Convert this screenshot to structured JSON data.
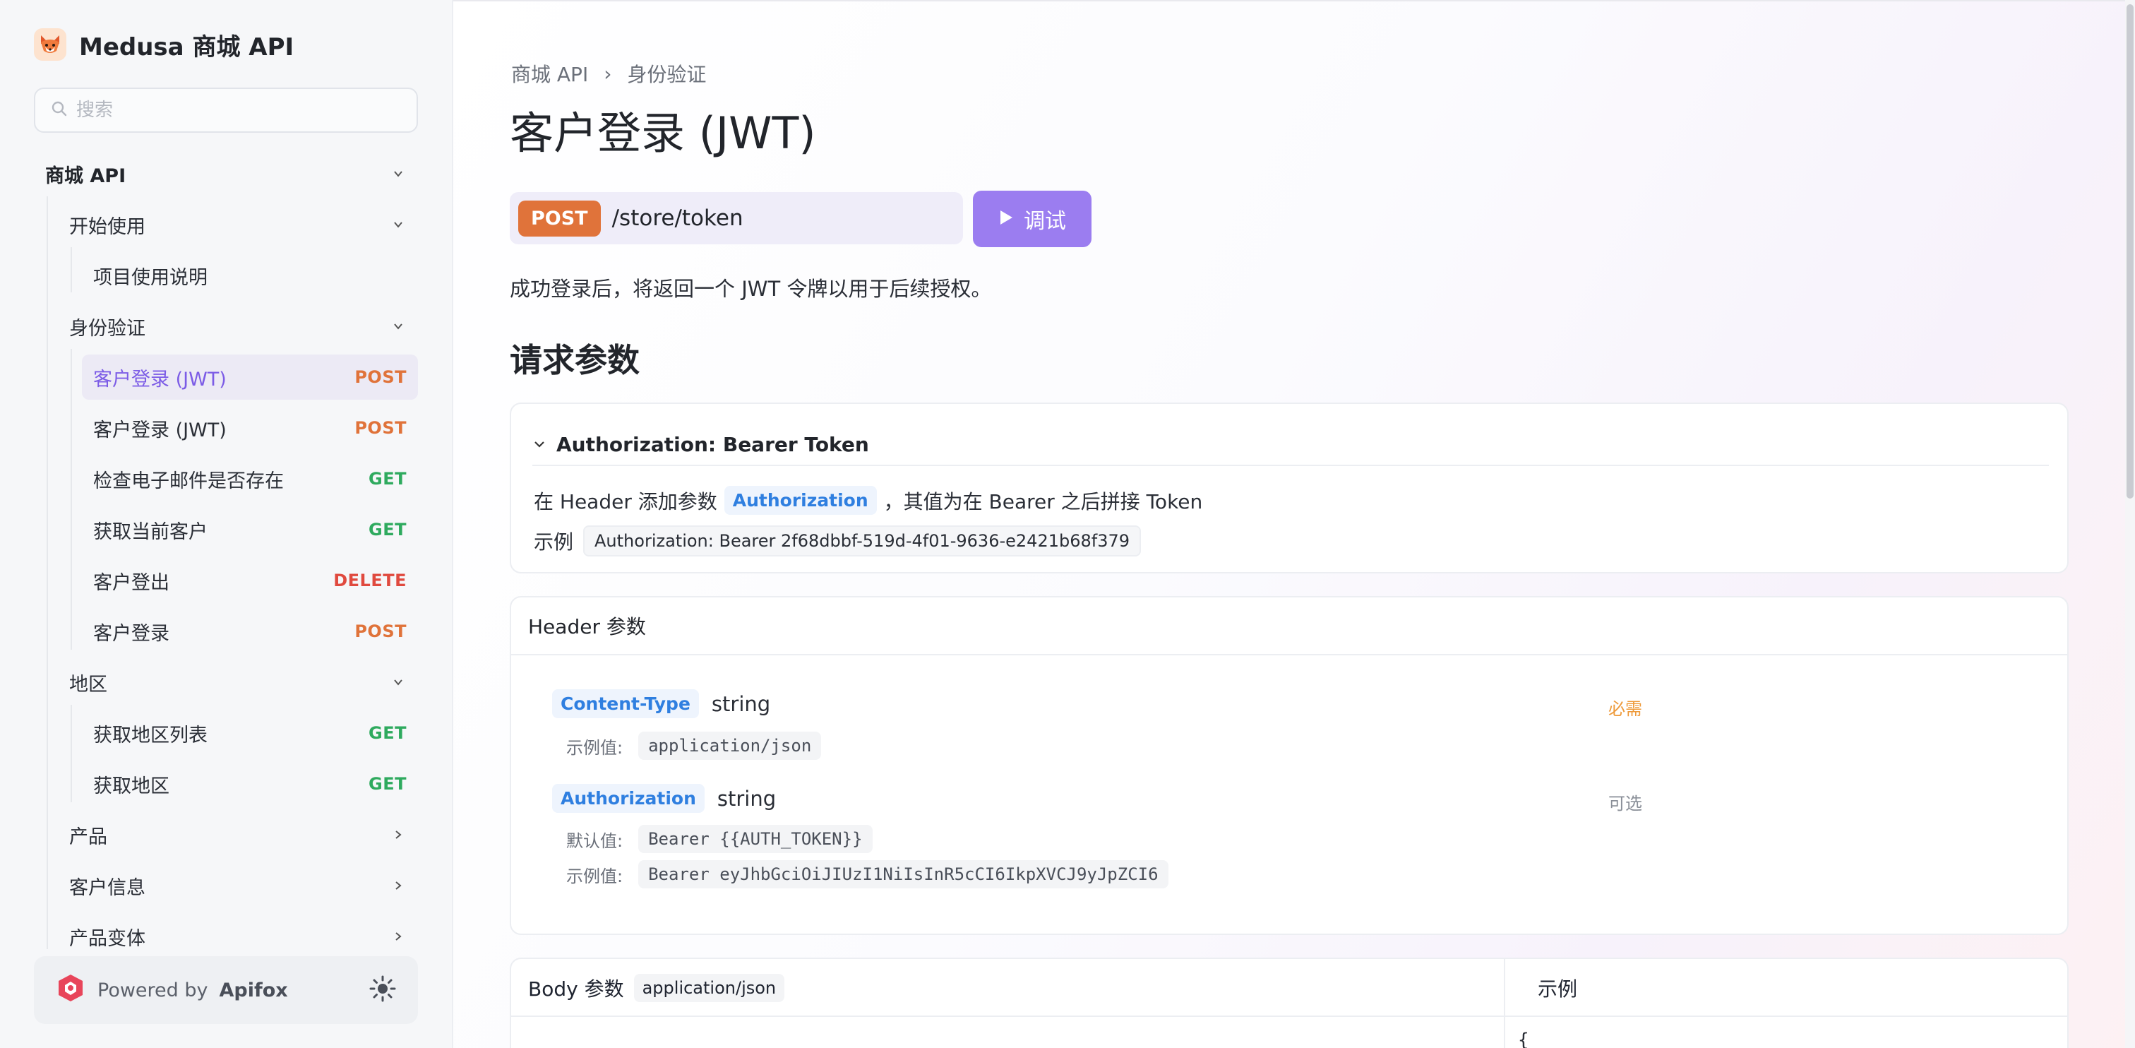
{
  "app": {
    "title": "Medusa 商城 API"
  },
  "search": {
    "placeholder": "搜索"
  },
  "sidebar": {
    "items": [
      {
        "label": "商城 API"
      },
      {
        "label": "开始使用"
      },
      {
        "label": "项目使用说明"
      },
      {
        "label": "身份验证"
      },
      {
        "label": "客户登录 (JWT)",
        "method": "POST"
      },
      {
        "label": "客户登录 (JWT)",
        "method": "POST"
      },
      {
        "label": "检查电子邮件是否存在",
        "method": "GET"
      },
      {
        "label": "获取当前客户",
        "method": "GET"
      },
      {
        "label": "客户登出",
        "method": "DELETE"
      },
      {
        "label": "客户登录",
        "method": "POST"
      },
      {
        "label": "地区"
      },
      {
        "label": "获取地区列表",
        "method": "GET"
      },
      {
        "label": "获取地区",
        "method": "GET"
      },
      {
        "label": "产品"
      },
      {
        "label": "客户信息"
      },
      {
        "label": "产品变体"
      }
    ]
  },
  "footer": {
    "powered_prefix": "Powered by",
    "powered_brand": "Apifox"
  },
  "breadcrumb": {
    "root": "商城 API",
    "separator": "›",
    "current": "身份验证"
  },
  "page": {
    "title": "客户登录 (JWT)",
    "method": "POST",
    "path": "/store/token",
    "try_label": "调试",
    "description": "成功登录后，将返回一个 JWT 令牌以用于后续授权。",
    "section_request": "请求参数"
  },
  "auth": {
    "title": "Authorization: Bearer Token",
    "line_prefix": "在 Header 添加参数",
    "param": "Authorization",
    "line_suffix": "，其值为在 Bearer 之后拼接 Token",
    "example_label": "示例",
    "example_value": "Authorization: Bearer 2f68dbbf-519d-4f01-9636-e2421b68f379"
  },
  "header_params": {
    "title": "Header 参数",
    "params": [
      {
        "name": "Content-Type",
        "type": "string",
        "flag": "必需",
        "example_label": "示例值:",
        "example_value": "application/json"
      },
      {
        "name": "Authorization",
        "type": "string",
        "flag": "可选",
        "default_label": "默认值:",
        "default_value": "Bearer {{AUTH_TOKEN}}",
        "example_label": "示例值:",
        "example_value": "Bearer eyJhbGciOiJIUzI1NiIsInR5cCI6IkpXVCJ9yJpZCI6"
      }
    ]
  },
  "body": {
    "title": "Body 参数",
    "content_type": "application/json",
    "example_title": "示例",
    "example_start": "{"
  },
  "colors": {
    "accent": "#9b7df0",
    "post": "#e0733a",
    "get": "#2eaa5e",
    "delete": "#e04a3f"
  }
}
